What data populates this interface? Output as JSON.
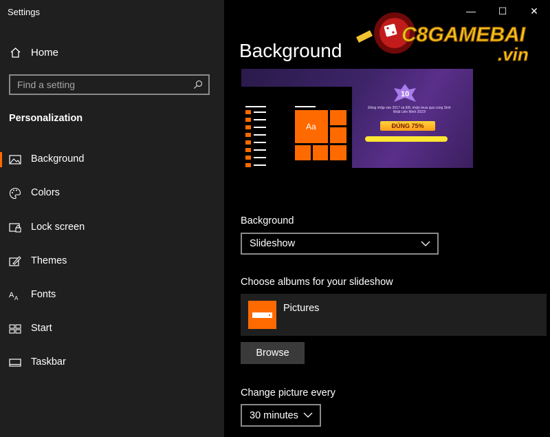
{
  "window": {
    "title": "Settings",
    "controls": {
      "minimize": "—",
      "maximize": "☐",
      "close": "✕"
    }
  },
  "sidebar": {
    "home_label": "Home",
    "search": {
      "placeholder": "Find a setting"
    },
    "section_title": "Personalization",
    "items": [
      {
        "label": "Background",
        "icon": "background-icon",
        "active": true
      },
      {
        "label": "Colors",
        "icon": "palette-icon",
        "active": false
      },
      {
        "label": "Lock screen",
        "icon": "lock-screen-icon",
        "active": false
      },
      {
        "label": "Themes",
        "icon": "themes-icon",
        "active": false
      },
      {
        "label": "Fonts",
        "icon": "fonts-icon",
        "active": false
      },
      {
        "label": "Start",
        "icon": "start-icon",
        "active": false
      },
      {
        "label": "Taskbar",
        "icon": "taskbar-icon",
        "active": false
      }
    ]
  },
  "main": {
    "title": "Background",
    "preview": {
      "tile_text": "Aa",
      "promo_lines": "Đăng nhập vào 2017 và 8/8, nhận mưa quà cùng Sinh Nhật Liên Minh 2023!",
      "promo_badge": "ĐÚNG 75%"
    },
    "background_label": "Background",
    "background_value": "Slideshow",
    "albums_label": "Choose albums for your slideshow",
    "album_name": "Pictures",
    "browse_label": "Browse",
    "change_label": "Change picture every",
    "change_value": "30 minutes"
  },
  "watermark": {
    "text": "C8GAMEBAI",
    "suffix": ".vin"
  },
  "colors": {
    "accent": "#ff6a00",
    "sidebar_bg": "#1f1f1f",
    "main_bg": "#000000"
  }
}
